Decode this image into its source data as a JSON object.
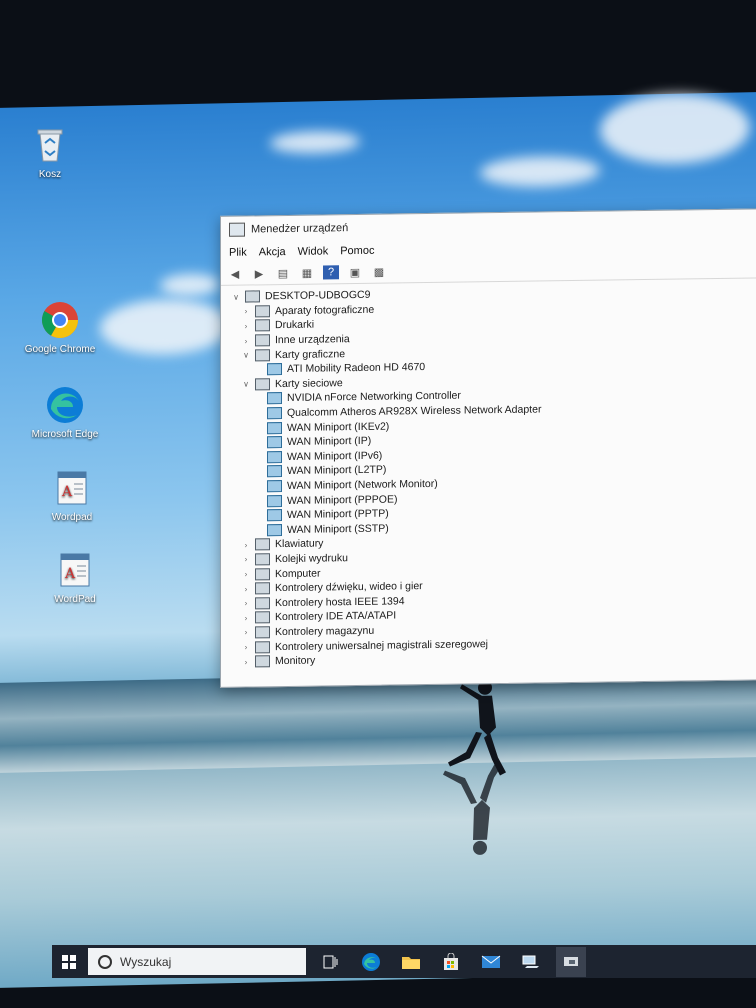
{
  "desktop": {
    "icons": [
      {
        "label": "Kosz",
        "icon": "recycle-bin-icon"
      },
      {
        "label": "Google Chrome",
        "icon": "chrome-icon"
      },
      {
        "label": "Microsoft Edge",
        "icon": "edge-icon"
      },
      {
        "label": "Wordpad",
        "icon": "wordpad-icon"
      },
      {
        "label": "WordPad",
        "icon": "wordpad-icon"
      }
    ]
  },
  "window": {
    "title": "Menedżer urządzeń",
    "menu": [
      "Plik",
      "Akcja",
      "Widok",
      "Pomoc"
    ],
    "toolbar_icons": [
      "back-icon",
      "forward-icon",
      "properties-icon",
      "show-hide-icon",
      "help-icon",
      "update-driver-icon",
      "scan-hardware-icon"
    ],
    "tree": {
      "root": "DESKTOP-UDBOGC9",
      "items": [
        {
          "label": "Aparaty fotograficzne",
          "level": 1,
          "expanded": false
        },
        {
          "label": "Drukarki",
          "level": 1,
          "expanded": false
        },
        {
          "label": "Inne urządzenia",
          "level": 1,
          "expanded": false
        },
        {
          "label": "Karty graficzne",
          "level": 1,
          "expanded": true
        },
        {
          "label": "ATI Mobility Radeon HD 4670",
          "level": 2
        },
        {
          "label": "Karty sieciowe",
          "level": 1,
          "expanded": true
        },
        {
          "label": "NVIDIA nForce Networking Controller",
          "level": 2
        },
        {
          "label": "Qualcomm Atheros AR928X Wireless Network Adapter",
          "level": 2
        },
        {
          "label": "WAN Miniport (IKEv2)",
          "level": 2
        },
        {
          "label": "WAN Miniport (IP)",
          "level": 2
        },
        {
          "label": "WAN Miniport (IPv6)",
          "level": 2
        },
        {
          "label": "WAN Miniport (L2TP)",
          "level": 2
        },
        {
          "label": "WAN Miniport (Network Monitor)",
          "level": 2
        },
        {
          "label": "WAN Miniport (PPPOE)",
          "level": 2
        },
        {
          "label": "WAN Miniport (PPTP)",
          "level": 2
        },
        {
          "label": "WAN Miniport (SSTP)",
          "level": 2
        },
        {
          "label": "Klawiatury",
          "level": 1,
          "expanded": false
        },
        {
          "label": "Kolejki wydruku",
          "level": 1,
          "expanded": false
        },
        {
          "label": "Komputer",
          "level": 1,
          "expanded": false
        },
        {
          "label": "Kontrolery dźwięku, wideo i gier",
          "level": 1,
          "expanded": false
        },
        {
          "label": "Kontrolery hosta IEEE 1394",
          "level": 1,
          "expanded": false
        },
        {
          "label": "Kontrolery IDE ATA/ATAPI",
          "level": 1,
          "expanded": false
        },
        {
          "label": "Kontrolery magazynu",
          "level": 1,
          "expanded": false
        },
        {
          "label": "Kontrolery uniwersalnej magistrali szeregowej",
          "level": 1,
          "expanded": false
        },
        {
          "label": "Monitory",
          "level": 1,
          "expanded": false
        }
      ]
    }
  },
  "taskbar": {
    "search_placeholder": "Wyszukaj",
    "icons": [
      "start-icon",
      "task-view-icon",
      "edge-icon",
      "file-explorer-icon",
      "store-icon",
      "mail-icon",
      "network-icon",
      "device-manager-icon"
    ]
  }
}
